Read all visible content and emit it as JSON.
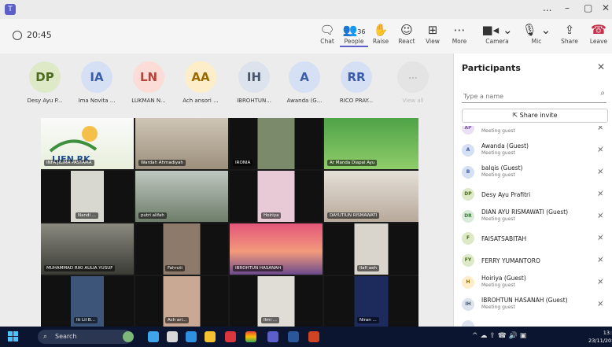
{
  "window": {
    "controls": [
      "...",
      "–",
      "▢",
      "✕"
    ]
  },
  "toolbar": {
    "timer": "20:45",
    "buttons": [
      {
        "label": "Chat",
        "icon": "chat-icon"
      },
      {
        "label": "People",
        "icon": "people-icon",
        "badge": "36"
      },
      {
        "label": "Raise",
        "icon": "raise-hand-icon"
      },
      {
        "label": "React",
        "icon": "react-icon"
      },
      {
        "label": "View",
        "icon": "view-icon"
      },
      {
        "label": "More",
        "icon": "more-icon"
      },
      {
        "label": "Camera",
        "icon": "camera-icon"
      },
      {
        "label": "Mic",
        "icon": "mic-icon"
      },
      {
        "label": "Share",
        "icon": "share-icon"
      }
    ],
    "leave_label": "Leave"
  },
  "stage": {
    "avatars": [
      {
        "initials": "DP",
        "name": "Desy Ayu P...",
        "bg": "#dde9c7",
        "fg": "#4d6b1d"
      },
      {
        "initials": "IA",
        "name": "Ima Novita ...",
        "bg": "#d6e0f5",
        "fg": "#3b5ca8"
      },
      {
        "initials": "LN",
        "name": "LUKMAN N...",
        "bg": "#fbdcd7",
        "fg": "#b3453a"
      },
      {
        "initials": "AA",
        "name": "Ach ansori ...",
        "bg": "#fdeec9",
        "fg": "#9a6a00"
      },
      {
        "initials": "IH",
        "name": "IBROHTUN...",
        "bg": "#dde3ec",
        "fg": "#46556b"
      },
      {
        "initials": "A",
        "name": "Awanda (G...",
        "bg": "#d6e0f5",
        "fg": "#3b5ca8"
      },
      {
        "initials": "RR",
        "name": "RICO PRAY...",
        "bg": "#d6e0f5",
        "fg": "#3b5ca8"
      },
      {
        "initials": "...",
        "name": "View all",
        "bg": "#e4e4e4",
        "fg": "#bbbbbb"
      }
    ],
    "video_labels": [
      "INFA JILIMA PASTAMA",
      "Wardah Ahmadiyah",
      "IRONIA",
      "Ar Manda Diapal Ayu",
      "Nandi ...",
      "putri alifah",
      "Hoiriya",
      "DAYUTIUN RISMAWATI",
      "MUHAMMAD RIKI AULIA YUSUF",
      "Fahruti",
      "IBROHTUN HASANAH",
      "Ilafi aeh",
      "Iti Lil B...",
      "Ach ari...",
      "Ilmi ...",
      "Niran ..."
    ]
  },
  "panel": {
    "title": "Participants",
    "search_placeholder": "Type a name",
    "share_invite": "Share invite",
    "participants": [
      {
        "initials": "AP",
        "name": "",
        "sub": "Meeting guest",
        "bg": "#e9e0f4",
        "fg": "#7a5aa5"
      },
      {
        "initials": "A",
        "name": "Awanda (Guest)",
        "sub": "Meeting guest",
        "bg": "#d6e0f5",
        "fg": "#3b5ca8"
      },
      {
        "initials": "B",
        "name": "balqis (Guest)",
        "sub": "Meeting guest",
        "bg": "#d6e0f5",
        "fg": "#3b5ca8"
      },
      {
        "initials": "DP",
        "name": "Desy Ayu Prafitri",
        "sub": "",
        "bg": "#dde9c7",
        "fg": "#4d6b1d"
      },
      {
        "initials": "DR",
        "name": "DIAN AYU RISMAWATI (Guest)",
        "sub": "Meeting guest",
        "bg": "#d9ead9",
        "fg": "#3d7a3d"
      },
      {
        "initials": "F",
        "name": "FAISATSABITAH",
        "sub": "",
        "bg": "#dde9c7",
        "fg": "#4d6b1d"
      },
      {
        "initials": "FY",
        "name": "FERRY YUMANTORO",
        "sub": "",
        "bg": "#dde9c7",
        "fg": "#4d6b1d"
      },
      {
        "initials": "H",
        "name": "Hoiriya (Guest)",
        "sub": "Meeting guest",
        "bg": "#fdeec9",
        "fg": "#9a6a00"
      },
      {
        "initials": "IH",
        "name": "IBROHTUN HASANAH (Guest)",
        "sub": "Meeting guest",
        "bg": "#dde3ec",
        "fg": "#46556b"
      },
      {
        "initials": "",
        "name": "",
        "sub": "",
        "bg": "#dde3ec",
        "fg": "#46556b"
      }
    ]
  },
  "taskbar": {
    "search_label": "Search",
    "tray_text": "^  ☁  ⇧  ☎  🔊  ▣",
    "time": "13:2",
    "date": "23/11/202"
  }
}
